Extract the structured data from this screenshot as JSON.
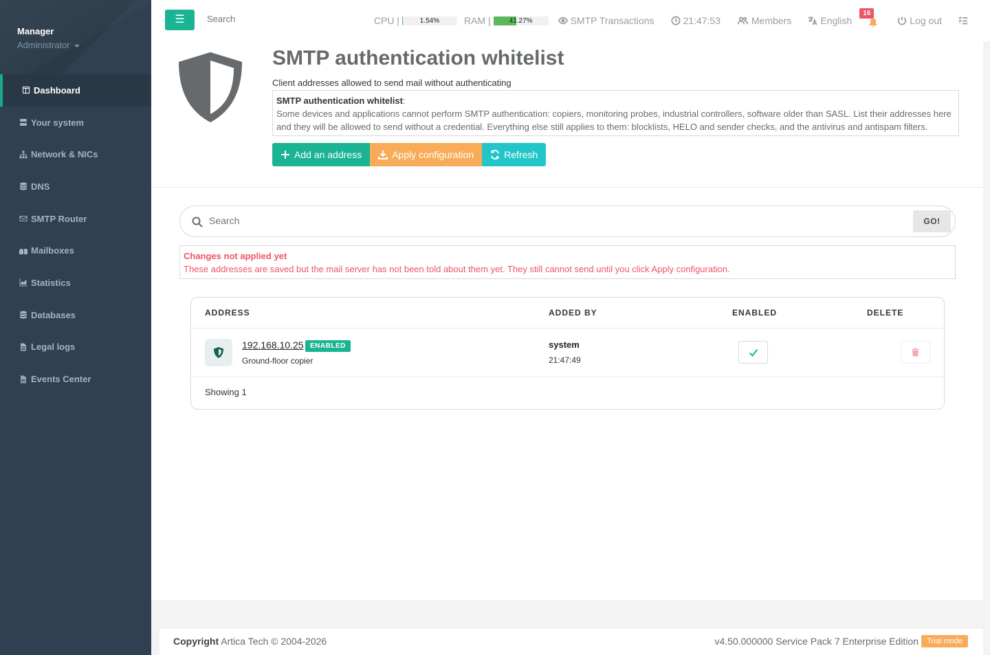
{
  "sidebar": {
    "profile_name": "Manager",
    "profile_role": "Administrator",
    "items": [
      {
        "label": "Dashboard",
        "icon": "dashboard-icon"
      },
      {
        "label": "Your system",
        "icon": "server-icon"
      },
      {
        "label": "Network & NICs",
        "icon": "sitemap-icon"
      },
      {
        "label": "DNS",
        "icon": "database-icon"
      },
      {
        "label": "SMTP Router",
        "icon": "envelope-icon"
      },
      {
        "label": "Mailboxes",
        "icon": "mailbox-icon"
      },
      {
        "label": "Statistics",
        "icon": "chart-icon"
      },
      {
        "label": "Databases",
        "icon": "database-icon"
      },
      {
        "label": "Legal logs",
        "icon": "file-icon"
      },
      {
        "label": "Events Center",
        "icon": "file-alt-icon"
      }
    ]
  },
  "topbar": {
    "search_placeholder": "Search",
    "cpu_label": "CPU",
    "cpu_value": "1.54%",
    "cpu_fraction": 0.0154,
    "ram_label": "RAM",
    "ram_value": "41.27%",
    "ram_fraction": 0.4127,
    "smtp_transactions": "SMTP Transactions",
    "clock": "21:47:53",
    "members": "Members",
    "language": "English",
    "notifications_count": "16",
    "logout": "Log out"
  },
  "page": {
    "title": "SMTP authentication whitelist",
    "subtitle": "Client addresses allowed to send mail without authenticating",
    "explain_title": "SMTP authentication whitelist",
    "explain_text": "Some devices and applications cannot perform SMTP authentication: copiers, monitoring probes, industrial controllers, software older than SASL. List their addresses here and they will be allowed to send without a credential. Everything else still applies to them: blocklists, HELO and sender checks, and the antivirus and antispam filters.",
    "btn_add": "Add an address",
    "btn_apply": "Apply configuration",
    "btn_refresh": "Refresh"
  },
  "search": {
    "placeholder": "Search",
    "go_label": "GO!"
  },
  "alert": {
    "title": "Changes not applied yet",
    "text": "These addresses are saved but the mail server has not been told about them yet. They still cannot send until you click Apply configuration."
  },
  "table": {
    "headers": {
      "address": "ADDRESS",
      "added_by": "ADDED BY",
      "enabled": "ENABLED",
      "delete": "DELETE"
    },
    "rows": [
      {
        "address": "192.168.10.25",
        "status": "ENABLED",
        "description": "Ground-floor copier",
        "added_by": "system",
        "added_time": "21:47:49",
        "enabled": true
      }
    ],
    "showing": "Showing 1"
  },
  "footer": {
    "copyright_label": "Copyright",
    "copyright_text": "Artica Tech © 2004-2026",
    "version": "v4.50.000000 Service Pack 7 Enterprise Edition",
    "trial": "Trial mode"
  },
  "colors": {
    "sidebar_bg": "#2f4050",
    "accent_green": "#1ab394",
    "accent_orange": "#f8ac59",
    "accent_cyan": "#23c6c8",
    "danger": "#ed5565"
  }
}
